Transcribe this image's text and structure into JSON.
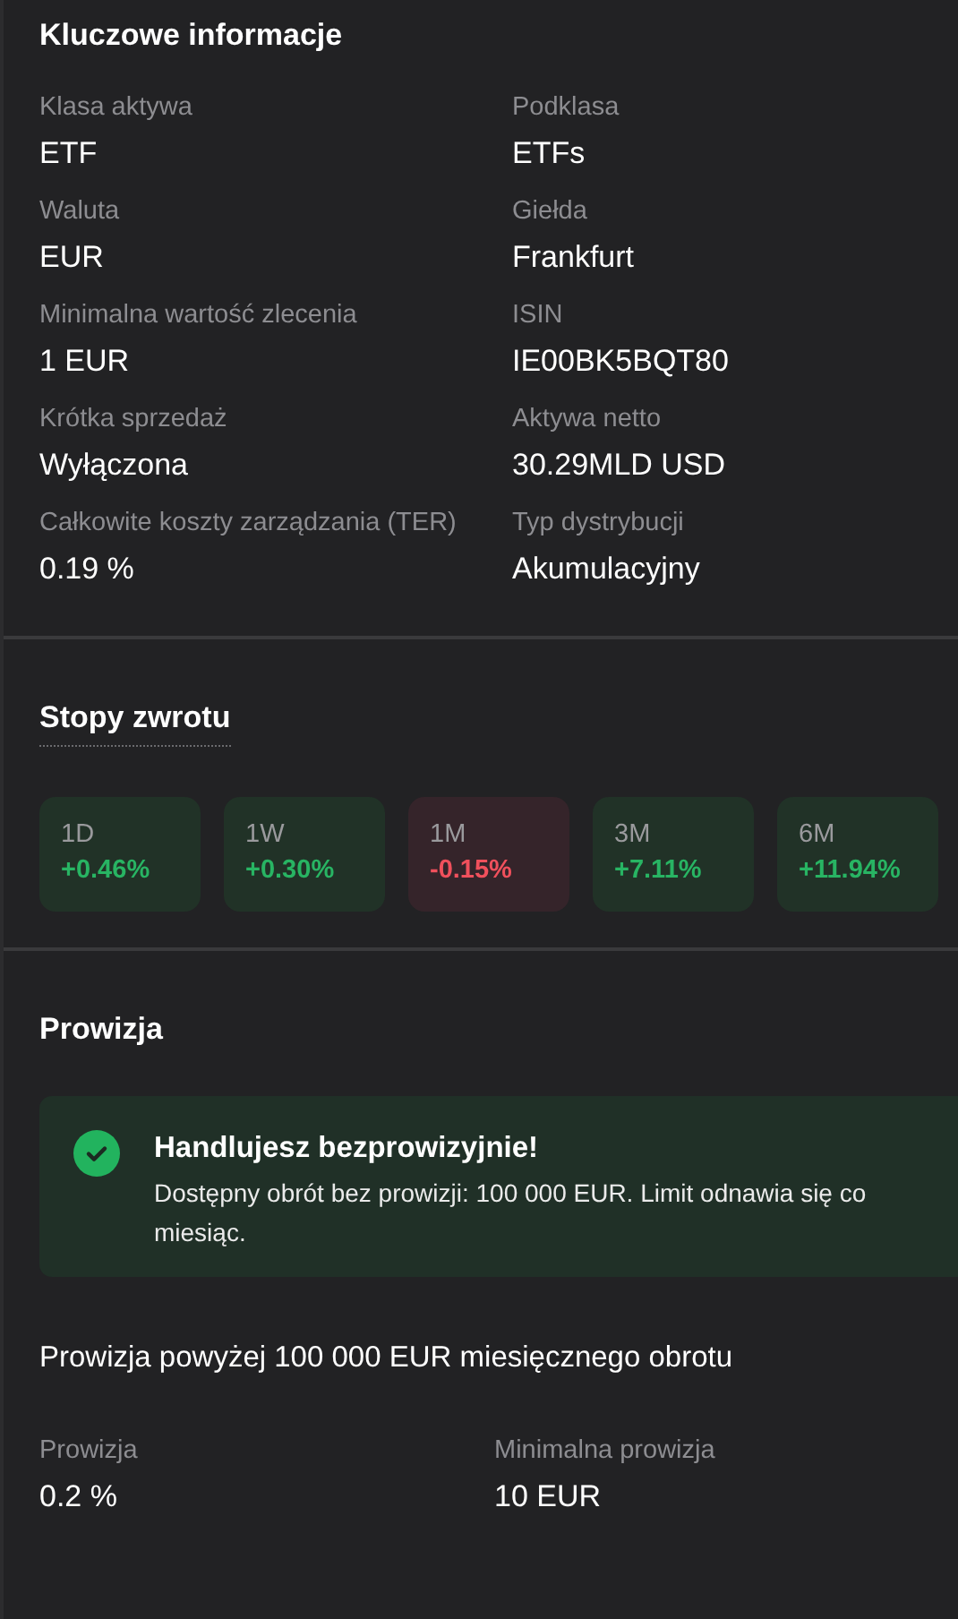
{
  "key_info": {
    "title": "Kluczowe informacje",
    "fields": [
      {
        "label": "Klasa aktywa",
        "value": "ETF"
      },
      {
        "label": "Podklasa",
        "value": "ETFs"
      },
      {
        "label": "Waluta",
        "value": "EUR"
      },
      {
        "label": "Giełda",
        "value": "Frankfurt"
      },
      {
        "label": "Minimalna wartość zlecenia",
        "value": "1 EUR"
      },
      {
        "label": "ISIN",
        "value": "IE00BK5BQT80"
      },
      {
        "label": "Krótka sprzedaż",
        "value": "Wyłączona"
      },
      {
        "label": "Aktywa netto",
        "value": "30.29MLD USD"
      },
      {
        "label": "Całkowite koszty zarządzania (TER)",
        "value": "0.19 %"
      },
      {
        "label": "Typ dystrybucji",
        "value": "Akumulacyjny"
      }
    ]
  },
  "returns": {
    "title": "Stopy zwrotu",
    "items": [
      {
        "period": "1D",
        "value": "+0.46%",
        "kind": "gain"
      },
      {
        "period": "1W",
        "value": "+0.30%",
        "kind": "gain"
      },
      {
        "period": "1M",
        "value": "-0.15%",
        "kind": "loss"
      },
      {
        "period": "3M",
        "value": "+7.11%",
        "kind": "gain"
      },
      {
        "period": "6M",
        "value": "+11.94%",
        "kind": "gain"
      }
    ]
  },
  "commission": {
    "title": "Prowizja",
    "notice": {
      "title": "Handlujesz bezprowizyjnie!",
      "text": "Dostępny obrót bez prowizji: 100 000 EUR. Limit odnawia się co miesiąc."
    },
    "subtitle": "Prowizja powyżej 100 000 EUR miesięcznego obrotu",
    "fields": [
      {
        "label": "Prowizja",
        "value": "0.2 %"
      },
      {
        "label": "Minimalna prowizja",
        "value": "10 EUR"
      }
    ]
  }
}
